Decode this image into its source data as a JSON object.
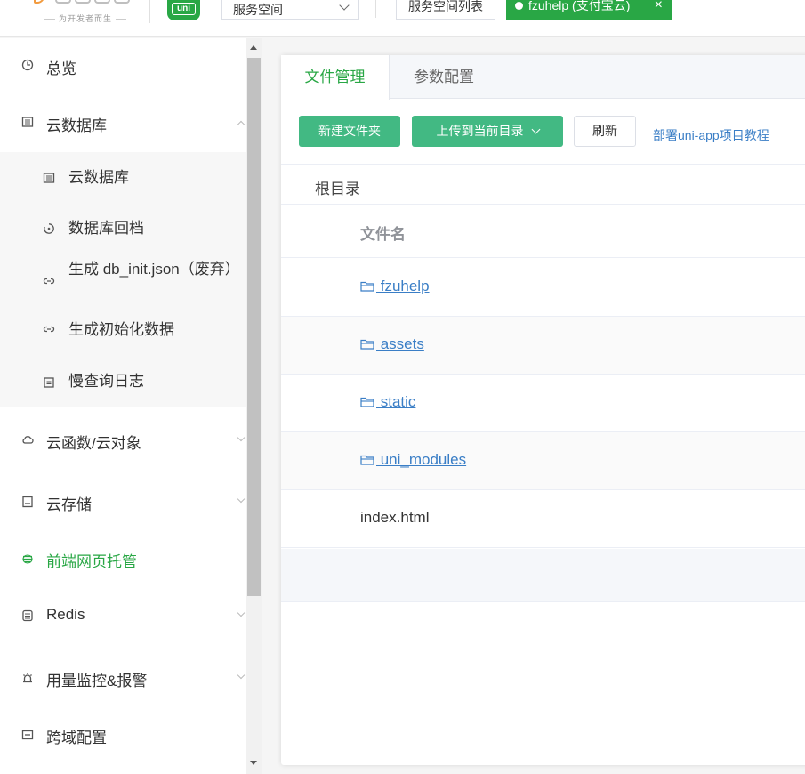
{
  "header": {
    "slogan": "为开发者而生",
    "uni_badge": "uni",
    "space_select_value": "服务空间",
    "space_list_label": "服务空间列表",
    "active_space": "fzuhelp (支付宝云)",
    "close_glyph": "×"
  },
  "sidebar": {
    "items": [
      {
        "label": "总览",
        "icon": "clock-icon"
      },
      {
        "label": "云数据库",
        "icon": "database-icon"
      },
      {
        "label": "云函数/云对象",
        "icon": "cloud-icon"
      },
      {
        "label": "云存储",
        "icon": "storage-icon"
      },
      {
        "label": "前端网页托管",
        "icon": "hosting-icon"
      },
      {
        "label": "Redis",
        "icon": "redis-icon"
      },
      {
        "label": "用量监控&报警",
        "icon": "alarm-icon"
      },
      {
        "label": "跨域配置",
        "icon": "cors-icon"
      }
    ],
    "submenu": [
      {
        "label": "云数据库",
        "icon": "database-icon"
      },
      {
        "label": "数据库回档",
        "icon": "restore-icon"
      },
      {
        "label": "生成 db_init.json（废弃）",
        "icon": "link-icon"
      },
      {
        "label": "生成初始化数据",
        "icon": "link-icon"
      },
      {
        "label": "慢查询日志",
        "icon": "log-icon"
      }
    ]
  },
  "main": {
    "tabs": [
      "文件管理",
      "参数配置"
    ],
    "buttons": {
      "new_folder": "新建文件夹",
      "upload": "上传到当前目录",
      "refresh": "刷新"
    },
    "tutorial_link": "部署uni-app项目教程",
    "breadcrumb": "根目录",
    "column_header": "文件名",
    "files": [
      {
        "name": " fzuhelp",
        "type": "folder"
      },
      {
        "name": " assets",
        "type": "folder"
      },
      {
        "name": " static",
        "type": "folder"
      },
      {
        "name": " uni_modules",
        "type": "folder"
      },
      {
        "name": "index.html",
        "type": "file"
      }
    ]
  },
  "colors": {
    "brand_green": "#29a745",
    "button_green": "#42b983",
    "link_blue": "#3a7ec6"
  }
}
